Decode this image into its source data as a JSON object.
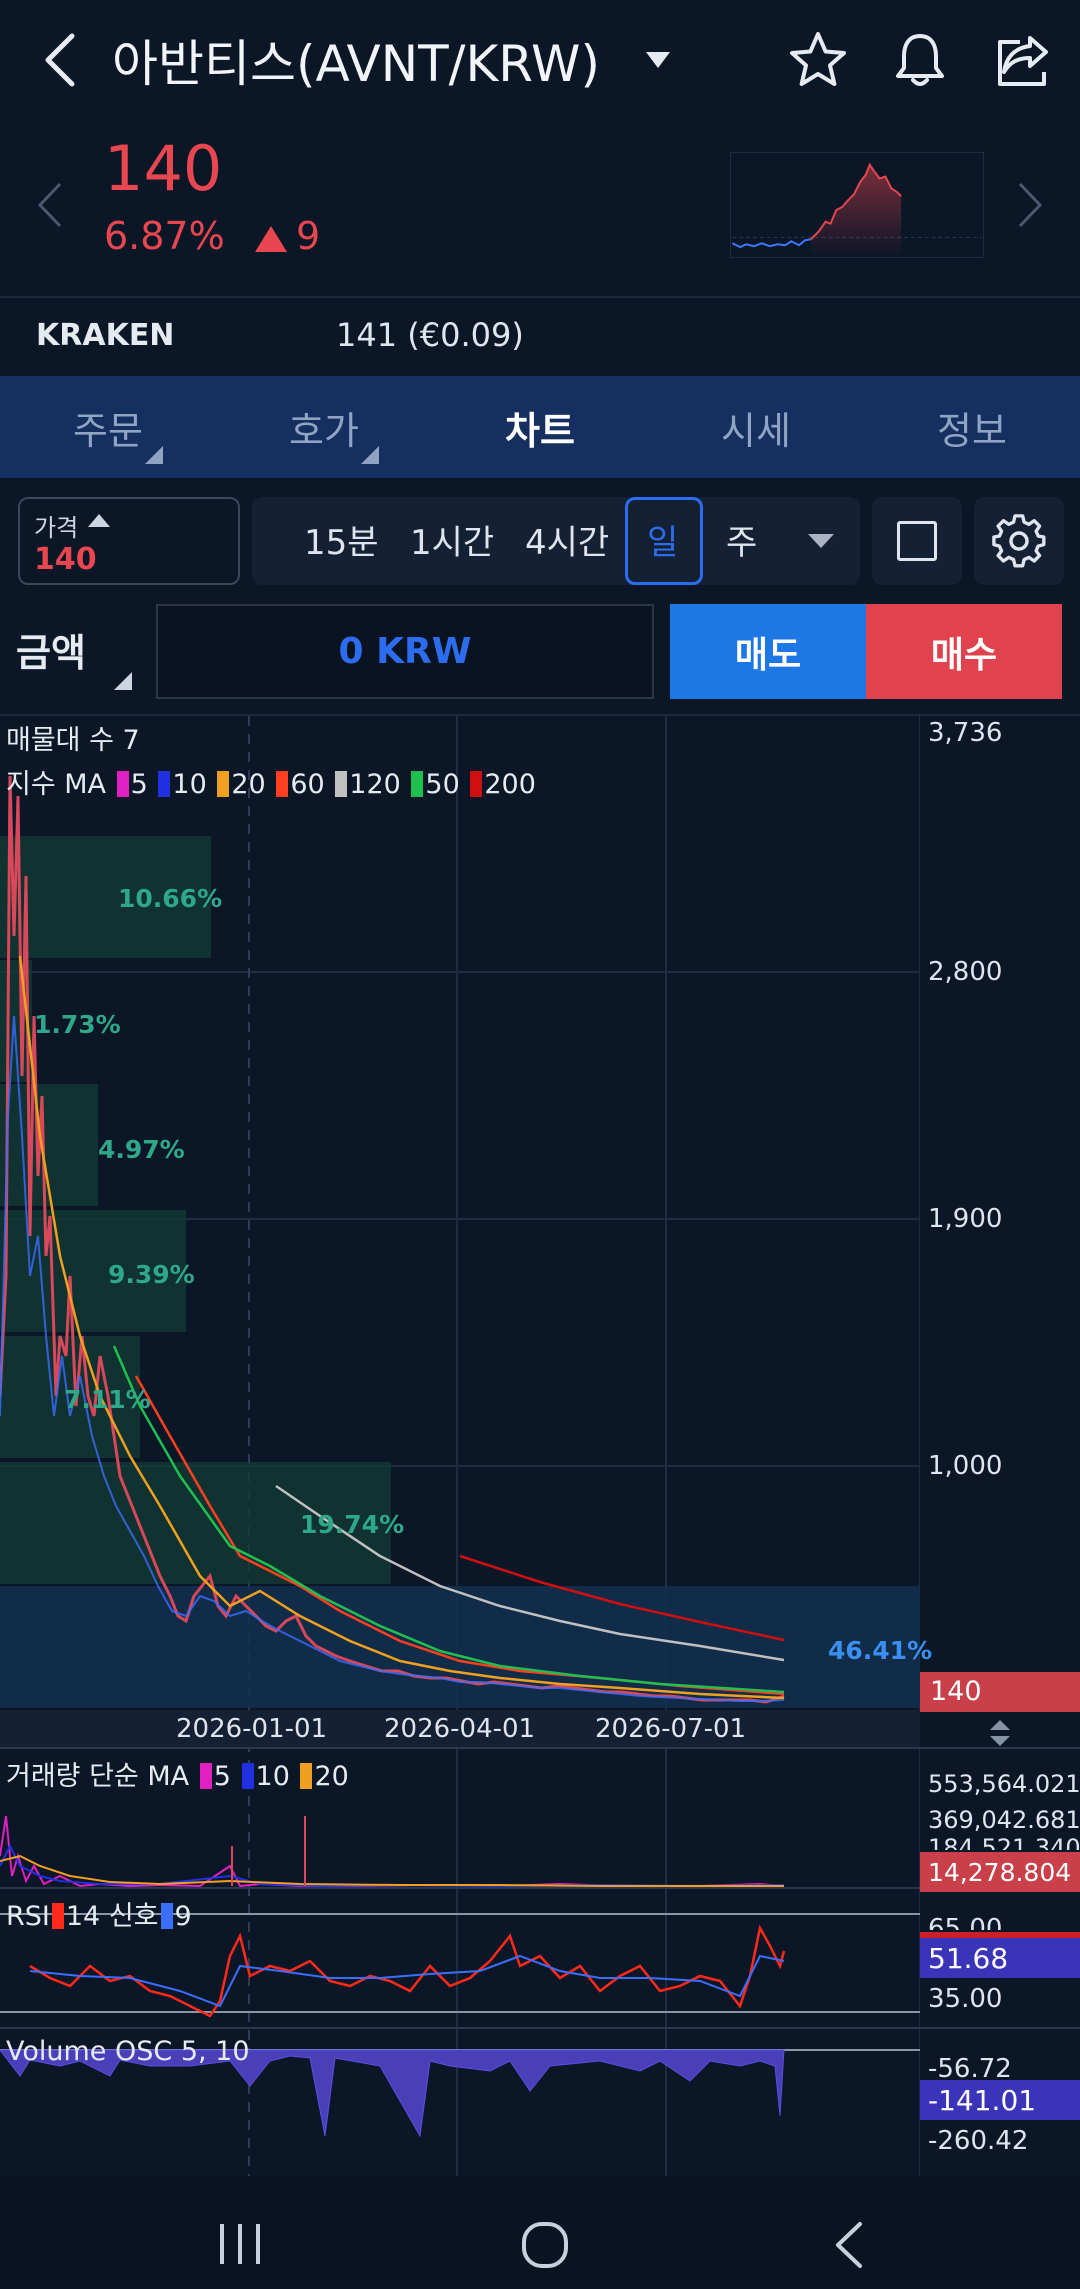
{
  "header": {
    "title": "아반티스(AVNT/KRW)",
    "icons": [
      "back-icon",
      "chevron-down-icon",
      "star-icon",
      "bell-icon",
      "share-icon"
    ]
  },
  "ticker": {
    "price": "140",
    "change_pct": "6.87%",
    "change_abs": "9",
    "color_up": "#e8474f"
  },
  "exchange": {
    "name": "KRAKEN",
    "price": "141 (€0.09)"
  },
  "tabs": [
    {
      "label": "주문",
      "has_menu": true
    },
    {
      "label": "호가",
      "has_menu": true
    },
    {
      "label": "차트",
      "active": true
    },
    {
      "label": "시세"
    },
    {
      "label": "정보"
    }
  ],
  "toolbar": {
    "price_selector_label": "가격",
    "price_selector_value": "140",
    "intervals": [
      "15분",
      "1시간",
      "4시간",
      "일",
      "주"
    ],
    "active_interval": "일"
  },
  "order": {
    "amount_label": "금액",
    "amount_value": "0 KRW",
    "sell_label": "매도",
    "buy_label": "매수",
    "sell_color": "#1d78e6",
    "buy_color": "#e0434d"
  },
  "chart": {
    "profile_label": "매물대 수 7",
    "ma_label": "지수 MA",
    "ma_periods": [
      {
        "label": "5",
        "color": "#e020c0"
      },
      {
        "label": "10",
        "color": "#2030e0"
      },
      {
        "label": "20",
        "color": "#f0a020"
      },
      {
        "label": "60",
        "color": "#ff4020"
      },
      {
        "label": "120",
        "color": "#c0c0c0"
      },
      {
        "label": "50",
        "color": "#20c050"
      },
      {
        "label": "200",
        "color": "#d01010"
      }
    ],
    "price_axis": [
      "3,736",
      "2,800",
      "1,900",
      "1,000"
    ],
    "current_price_tag": "140",
    "date_axis": [
      "2026-01-01",
      "2026-04-01",
      "2026-07-01"
    ],
    "volume_profile": [
      "10.66%",
      "1.73%",
      "4.97%",
      "9.39%",
      "7.11%",
      "19.74%",
      "46.41%"
    ],
    "volume_panel": {
      "label": "거래량 단순 MA",
      "ma_periods": [
        {
          "label": "5",
          "color": "#e020c0"
        },
        {
          "label": "10",
          "color": "#2030e0"
        },
        {
          "label": "20",
          "color": "#f0a020"
        }
      ],
      "axis": [
        "553,564.021",
        "369,042.681",
        "184,521.340"
      ],
      "current_tag": "14,278.804"
    },
    "rsi_panel": {
      "label": "RSI",
      "period": "14",
      "signal_label": "신호",
      "signal_period": "9",
      "axis": [
        "65.00",
        "35.00"
      ],
      "current_tag": "51.68"
    },
    "osc_panel": {
      "label": "Volume OSC 5, 10",
      "axis": [
        "-56.72",
        "-260.42"
      ],
      "current_tag": "-141.01"
    }
  },
  "navbar": {
    "icons": [
      "recent-apps-icon",
      "home-icon",
      "back-nav-icon"
    ]
  }
}
